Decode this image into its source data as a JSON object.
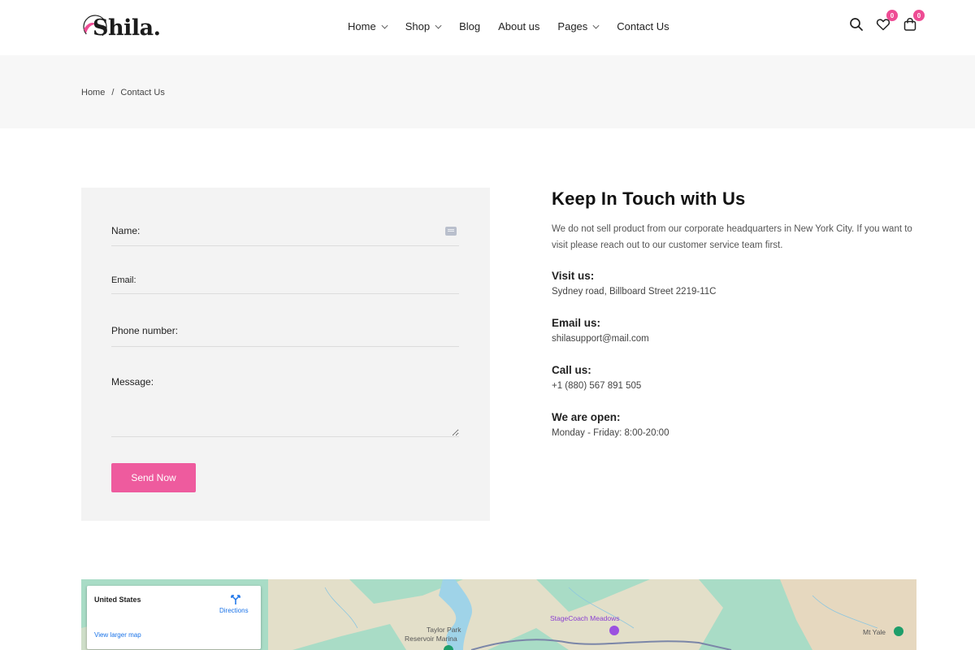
{
  "brand": {
    "name": "Shila.",
    "accent": "#ee4c94"
  },
  "nav": {
    "items": [
      {
        "label": "Home",
        "dropdown": true
      },
      {
        "label": "Shop",
        "dropdown": true
      },
      {
        "label": "Blog",
        "dropdown": false
      },
      {
        "label": "About us",
        "dropdown": false
      },
      {
        "label": "Pages",
        "dropdown": true
      },
      {
        "label": "Contact Us",
        "dropdown": false
      }
    ]
  },
  "header_icons": {
    "wishlist_count": "0",
    "cart_count": "0"
  },
  "breadcrumb": {
    "home": "Home",
    "separator": "/",
    "current": "Contact Us"
  },
  "form": {
    "name_label": "Name:",
    "email_label": "Email:",
    "phone_label": "Phone number:",
    "message_label": "Message:",
    "submit_label": "Send Now"
  },
  "info": {
    "title": "Keep In Touch with Us",
    "intro": "We do not sell product from our corporate headquarters in New York City. If you want to visit please reach out to our customer service team first.",
    "blocks": [
      {
        "heading": "Visit us:",
        "text": "Sydney road, Billboard Street 2219-11C"
      },
      {
        "heading": "Email us:",
        "text": "shilasupport@mail.com"
      },
      {
        "heading": "Call us:",
        "text": "+1 (880) 567 891 505"
      },
      {
        "heading": "We are open:",
        "text": "Monday - Friday: 8:00-20:00"
      }
    ]
  },
  "map": {
    "place": "United States",
    "directions": "Directions",
    "larger_map": "View larger map",
    "labels": [
      "Taylor Park",
      "Reservoir Marina",
      "StageCoach Meadows",
      "Mt Yale"
    ]
  }
}
